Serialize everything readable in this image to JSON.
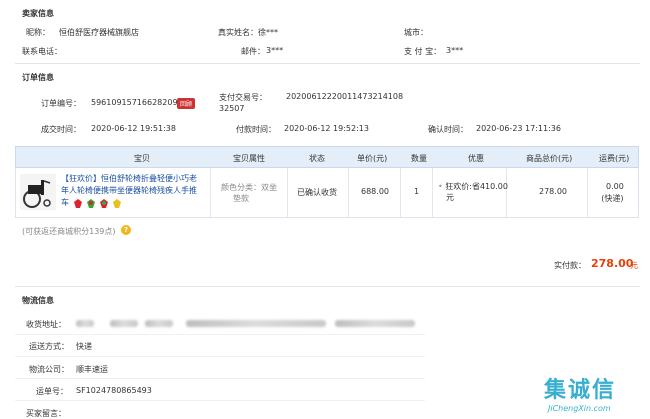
{
  "seller": {
    "title": "卖家信息",
    "nick_label": "昵称：",
    "nick_value": "恒伯舒医疗器械旗舰店",
    "name_label": "真实姓名：",
    "name_value": "徐***",
    "city_label": "城市：",
    "phone_label": "联系电话：",
    "email_label": "邮件：",
    "email_value": "3***",
    "alipay_label": "支 付 宝：",
    "alipay_value": "3***"
  },
  "order": {
    "title": "订单信息",
    "no_label": "订单编号：",
    "no_value": "596109157166282094",
    "no_badge": "回顾",
    "trade_label": "支付交易号：",
    "trade_value_1": "20200612220011473214108",
    "trade_value_2": "32507",
    "created_label": "成交时间：",
    "created_value": "2020-06-12 19:51:38",
    "paid_label": "付款时间：",
    "paid_value": "2020-06-12 19:52:13",
    "confirm_label": "确认时间：",
    "confirm_value": "2020-06-23 17:11:36"
  },
  "table": {
    "headers": [
      "宝贝",
      "宝贝属性",
      "状态",
      "单价(元)",
      "数量",
      "优惠",
      "商品总价(元)",
      "运费(元)"
    ],
    "item": {
      "title_1": "【狂欢价】恒伯舒轮椅折叠轻便小巧老",
      "title_2": "年人轮椅便携带坐便器轮椅残疾人手推",
      "title_3": "车",
      "attr_1": "颜色分类：双坐",
      "attr_2": "垫款",
      "status": "已确认收货",
      "unit_price": "688.00",
      "qty": "1",
      "discount_1": "狂欢价:省410.00",
      "discount_2": "元",
      "total": "278.00",
      "freight_1": "0.00",
      "freight_2": "(快递)"
    }
  },
  "points_note": "(可获返还商城积分139点)",
  "payment": {
    "label": "实付款：",
    "value": "278.00",
    "unit": "元"
  },
  "logistics": {
    "title": "物流信息",
    "addr_label": "收货地址：",
    "method_label": "运送方式：",
    "method_value": "快递",
    "company_label": "物流公司：",
    "company_value": "顺丰速运",
    "tracking_label": "运单号：",
    "tracking_value": "SF1024780865493",
    "msg_label": "买家留言："
  },
  "watermark": {
    "text": "集诚信",
    "url": "JiChengXin.com"
  },
  "colors": {
    "accent": "#e4410c",
    "link": "#1a4fa0",
    "header_bg": "#e4eef9"
  }
}
